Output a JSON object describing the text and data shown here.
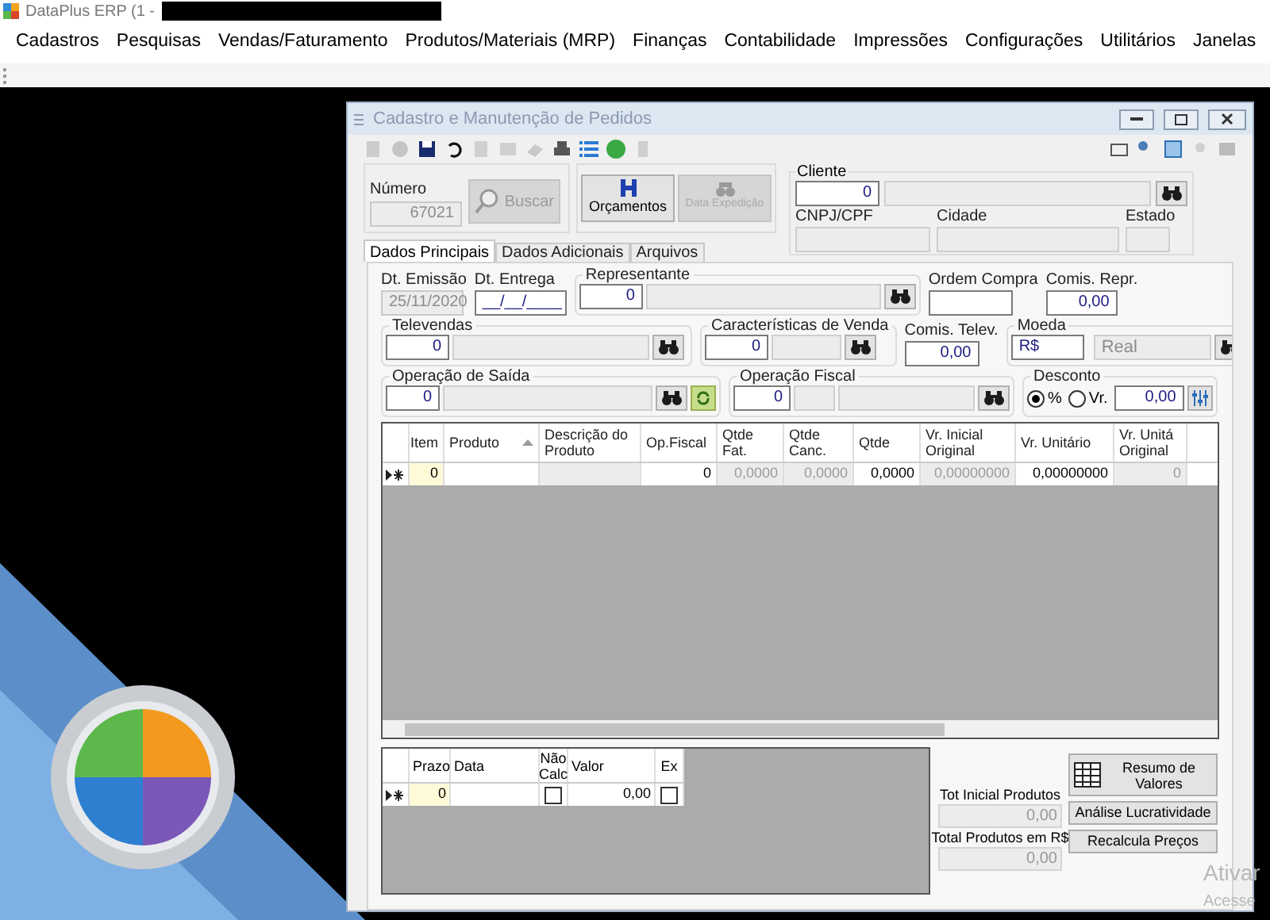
{
  "app": {
    "title": "DataPlus ERP (1 -"
  },
  "menu": [
    {
      "label": "Cadastros"
    },
    {
      "label": "Pesquisas"
    },
    {
      "label": "Vendas/Faturamento"
    },
    {
      "label": "Produtos/Materiais (MRP)"
    },
    {
      "label": "Finanças"
    },
    {
      "label": "Contabilidade"
    },
    {
      "label": "Impressões"
    },
    {
      "label": "Configurações"
    },
    {
      "label": "Utilitários"
    },
    {
      "label": "Janelas"
    }
  ],
  "window": {
    "title": "Cadastro e Manutenção de Pedidos"
  },
  "header": {
    "numero": {
      "label": "Número",
      "value": "67021"
    },
    "buttons": [
      {
        "label": "Buscar",
        "disabled": true
      },
      {
        "label": "Orçamentos",
        "disabled": false
      },
      {
        "label": "Data Expedição",
        "disabled": true
      }
    ],
    "cliente": {
      "label": "Cliente",
      "value": "0"
    },
    "fields": [
      {
        "label": "CNPJ/CPF"
      },
      {
        "label": "Cidade"
      },
      {
        "label": "Estado"
      }
    ]
  },
  "tabs": [
    {
      "label": "Dados Principais",
      "selected": true
    },
    {
      "label": "Dados Adicionais",
      "selected": false
    },
    {
      "label": "Arquivos",
      "selected": false
    }
  ],
  "form": {
    "dt_emissao": {
      "label": "Dt. Emissão",
      "value": "25/11/2020",
      "disabled": true
    },
    "dt_entrega": {
      "label": "Dt. Entrega",
      "value": "__/__/____",
      "disabled": false
    },
    "representante": {
      "label": "Representante",
      "value": "0"
    },
    "ordem_compra": {
      "label": "Ordem Compra"
    },
    "comis_repr": {
      "label": "Comis. Repr.",
      "value": "0,00"
    },
    "televendas": {
      "label": "Televendas",
      "value": "0"
    },
    "caracteristicas": {
      "label": "Características de Venda",
      "value": "0"
    },
    "comis_telev": {
      "label": "Comis. Telev.",
      "value": "0,00"
    },
    "moeda": {
      "label": "Moeda",
      "value": "R$",
      "description": "Real"
    },
    "operacao_saida": {
      "label": "Operação de Saída",
      "value": "0"
    },
    "operacao_fiscal": {
      "label": "Operação Fiscal",
      "value": "0"
    },
    "desconto": {
      "label": "Desconto",
      "options": [
        {
          "label": "%",
          "selected": true
        },
        {
          "label": "Vr.",
          "selected": false
        }
      ],
      "value": "0,00"
    }
  },
  "items_grid": {
    "columns": [
      {
        "label": "Item",
        "sorted": false
      },
      {
        "label": "Produto",
        "sorted": true
      },
      {
        "label": "Descrição do Produto",
        "sorted": false
      },
      {
        "label": "Op.Fiscal",
        "sorted": false
      },
      {
        "label": "Qtde Fat.",
        "sorted": false
      },
      {
        "label": "Qtde Canc.",
        "sorted": false
      },
      {
        "label": "Qtde",
        "sorted": false
      },
      {
        "label": "Vr. Inicial Original",
        "sorted": false
      },
      {
        "label": "Vr. Unitário",
        "sorted": false
      },
      {
        "label": "Vr. Unitá Original",
        "sorted": false
      }
    ],
    "rows": [
      {
        "cells": [
          {
            "value": "0",
            "readonly": false,
            "current": true
          },
          {
            "readonly": false
          },
          {
            "readonly": true
          },
          {
            "value": "0",
            "readonly": false
          },
          {
            "value": "0,0000",
            "readonly": true
          },
          {
            "value": "0,0000",
            "readonly": true
          },
          {
            "value": "0,0000",
            "readonly": false
          },
          {
            "value": "0,00000000",
            "readonly": true
          },
          {
            "value": "0,00000000",
            "readonly": false
          },
          {
            "value": "0",
            "readonly": true
          }
        ]
      }
    ]
  },
  "installments_grid": {
    "columns": [
      {
        "label": "Prazo"
      },
      {
        "label": "Data"
      },
      {
        "label": "Não Calc"
      },
      {
        "label": "Valor"
      },
      {
        "label": "Ex"
      }
    ],
    "rows": [
      {
        "cells": [
          {
            "kind": "text",
            "value": "0",
            "current": true
          },
          {
            "kind": "text"
          },
          {
            "kind": "check",
            "checked": false
          },
          {
            "kind": "text",
            "value": "0,00"
          },
          {
            "kind": "check",
            "checked": false
          }
        ]
      }
    ]
  },
  "totals": [
    {
      "label": "Tot Inicial Produtos",
      "value": "0,00"
    },
    {
      "label": "Total Produtos em R$",
      "value": "0,00"
    }
  ],
  "actions": [
    {
      "label": "Resumo de Valores",
      "kind": "icon"
    },
    {
      "label": "Análise Lucratividade",
      "kind": "plain"
    },
    {
      "label": "Recalcula Preços",
      "kind": "plain"
    }
  ],
  "system_notice": {
    "line_1": "Ativar",
    "line_2": "Acesse"
  }
}
